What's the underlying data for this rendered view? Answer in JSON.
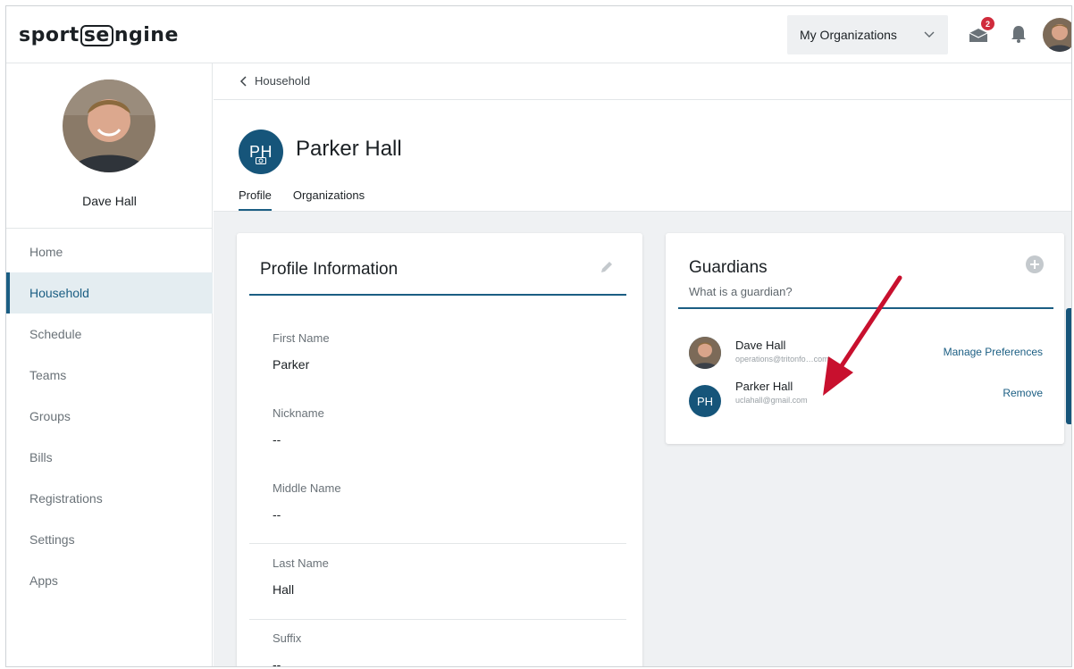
{
  "app": {
    "logo_text_1": "sport",
    "logo_text_2": "se",
    "logo_text_3": "ngine"
  },
  "topbar": {
    "org_select_value": "My Organizations",
    "messages_badge": "2"
  },
  "sidebar": {
    "user_name": "Dave Hall",
    "items": [
      {
        "label": "Home"
      },
      {
        "label": "Household"
      },
      {
        "label": "Schedule"
      },
      {
        "label": "Teams"
      },
      {
        "label": "Groups"
      },
      {
        "label": "Bills"
      },
      {
        "label": "Registrations"
      },
      {
        "label": "Settings"
      },
      {
        "label": "Apps"
      }
    ],
    "active_index": 1
  },
  "header": {
    "breadcrumb": "Household",
    "person_initials": "PH",
    "person_name": "Parker Hall",
    "tabs": [
      {
        "label": "Profile"
      },
      {
        "label": "Organizations"
      }
    ]
  },
  "profile": {
    "title": "Profile Information",
    "fields": [
      {
        "label": "First Name",
        "value": "Parker"
      },
      {
        "label": "Nickname",
        "value": "--"
      },
      {
        "label": "Middle Name",
        "value": "--"
      },
      {
        "label": "Last Name",
        "value": "Hall"
      },
      {
        "label": "Suffix",
        "value": "--"
      }
    ]
  },
  "guardians": {
    "title": "Guardians",
    "subtitle": "What is a guardian?",
    "rows": [
      {
        "name": "Dave Hall",
        "email": "operations@tritonfo…com",
        "action": "Manage Preferences"
      },
      {
        "name": "Parker Hall",
        "initials": "PH",
        "email": "uclahall@gmail.com",
        "action": "Remove"
      }
    ]
  },
  "colors": {
    "brand_blue": "#1b5e83",
    "avatar_blue": "#16557a",
    "badge_red": "#d02b3c",
    "arrow_red": "#c8102e"
  }
}
